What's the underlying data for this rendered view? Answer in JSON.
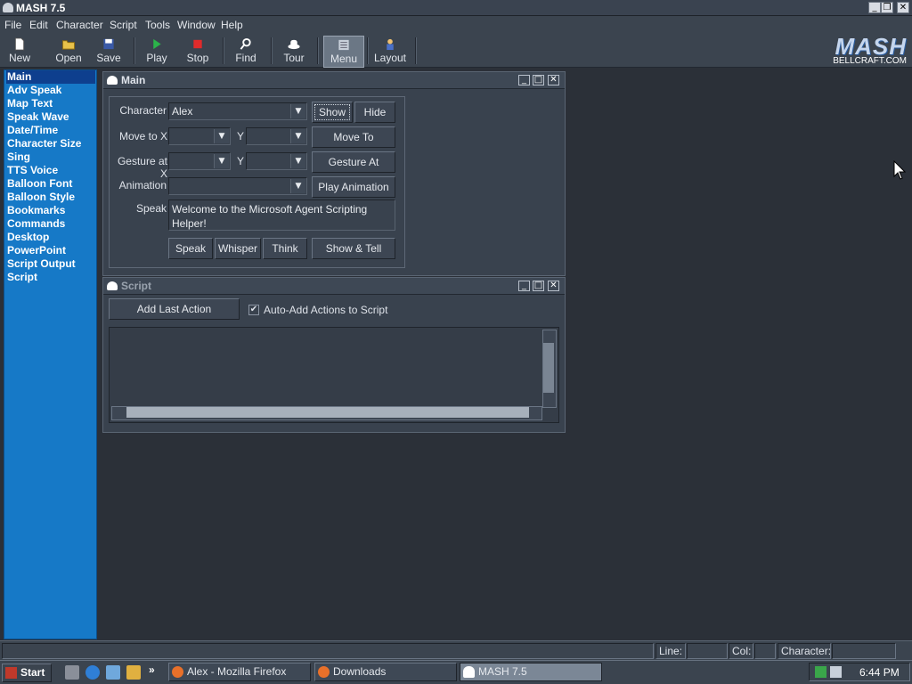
{
  "window": {
    "title": "MASH 7.5",
    "minimize": "_",
    "restore": "❐",
    "close": "✕"
  },
  "menu": [
    "File",
    "Edit",
    "Character",
    "Script",
    "Tools",
    "Window",
    "Help"
  ],
  "toolbar": [
    "New",
    "Open",
    "Save",
    "Play",
    "Stop",
    "Find",
    "Tour",
    "Menu",
    "Layout"
  ],
  "logo": {
    "text": "MASH",
    "sub": "BELLCRAFT.COM"
  },
  "sidebar": {
    "selected": "Main",
    "items": [
      "Main",
      "Adv Speak",
      "Map Text",
      "Speak Wave",
      "Date/Time",
      "Character Size",
      "Sing",
      "TTS Voice",
      "Balloon Font",
      "Balloon Style",
      "Bookmarks",
      "Commands",
      "Desktop",
      "PowerPoint",
      "Script Output",
      "Script"
    ]
  },
  "main": {
    "title": "Main",
    "character_label": "Character",
    "character_value": "Alex",
    "show": "Show",
    "hide": "Hide",
    "moveto_label": "Move to X",
    "y_label": "Y",
    "moveto_btn": "Move To",
    "gesture_label": "Gesture at X",
    "gesture_btn": "Gesture At",
    "animation_label": "Animation",
    "play_anim": "Play Animation",
    "speak_label": "Speak",
    "speak_text": "Welcome to the Microsoft Agent Scripting Helper!",
    "speak": "Speak",
    "whisper": "Whisper",
    "think": "Think",
    "show_tell": "Show & Tell"
  },
  "script": {
    "title": "Script",
    "add_last": "Add Last Action",
    "auto_add": "Auto-Add Actions to Script",
    "auto_add_checked": true
  },
  "status": {
    "line": "Line:",
    "col": "Col:",
    "character": "Character:"
  },
  "taskbar": {
    "start": "Start",
    "tasks": [
      "Alex - Mozilla Firefox",
      "Downloads",
      "MASH 7.5"
    ],
    "active_task": "MASH 7.5",
    "clock": "6:44 PM",
    "chevron": "»"
  },
  "colors": {
    "sidebar": "#1679c7",
    "sidebar_selected": "#0e3f8e",
    "workspace": "#2b3038",
    "chrome": "#3b444f"
  }
}
